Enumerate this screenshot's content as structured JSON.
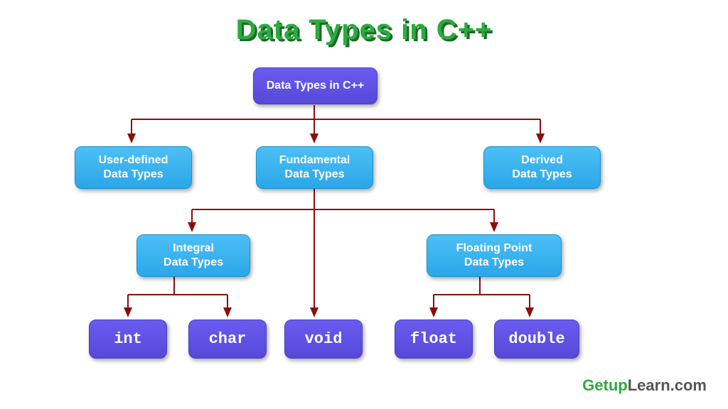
{
  "title": "Data Types in C++",
  "nodes": {
    "root": {
      "label": "Data Types in C++"
    },
    "userdef": {
      "line1": "User-defined",
      "line2": "Data Types"
    },
    "fundamental": {
      "line1": "Fundamental",
      "line2": "Data  Types"
    },
    "derived": {
      "line1": "Derived",
      "line2": "Data Types"
    },
    "integral": {
      "line1": "Integral",
      "line2": "Data Types"
    },
    "floating": {
      "line1": "Floating  Point",
      "line2": "Data Types"
    },
    "int": {
      "label": "int"
    },
    "char": {
      "label": "char"
    },
    "void": {
      "label": "void"
    },
    "float": {
      "label": "float"
    },
    "double": {
      "label": "double"
    }
  },
  "logo": {
    "highlight": "Getup",
    "rest": "Learn.com"
  },
  "colors": {
    "arrow": "#8b0e0e",
    "title": "#2eaa3f",
    "purple": "#5648d8",
    "blue": "#2aa7e8"
  }
}
